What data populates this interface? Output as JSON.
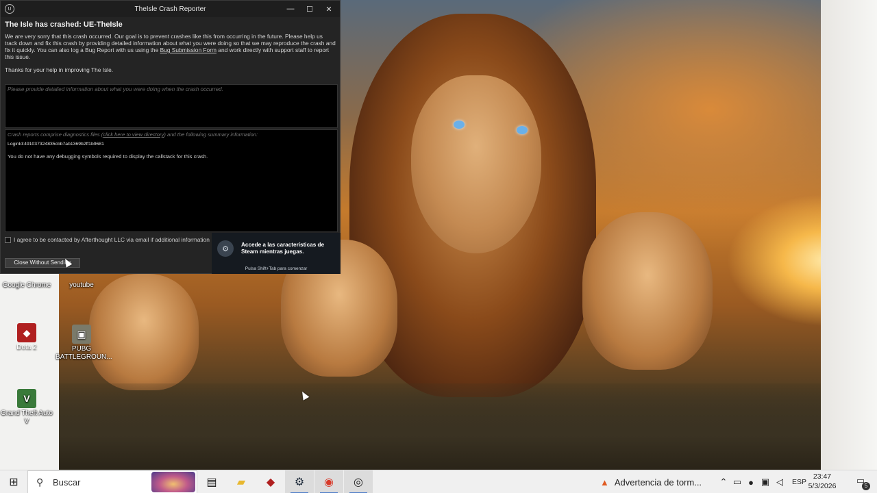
{
  "crash_reporter": {
    "window_title": "TheIsle Crash Reporter",
    "heading": "The Isle has crashed: UE-TheIsle",
    "intro_before_link": "We are very sorry that this crash occurred. Our goal is to prevent crashes like this from occurring in the future. Please help us track down and fix this crash by providing detailed information about what you were doing so that we may reproduce the crash and fix it quickly. You can also log a Bug Report with us using the ",
    "intro_link": "Bug Submission Form",
    "intro_after_link": " and work directly with support staff to report this issue.",
    "thanks": "Thanks for your help in improving The Isle.",
    "description_placeholder": "Please provide detailed information about what you were doing when the crash occurred.",
    "summary_before_link": "Crash reports comprise diagnostics files (",
    "summary_link": "click here to view directory",
    "summary_after_link": ") and the following summary information:",
    "login_id": "LoginId:491037324835cbb7ab1369b2ff1b9681",
    "callstack_msg": "You do not have any debugging symbols required to display the callstack for this crash.",
    "consent_label": "I agree to be contacted by Afterthought LLC via email if additional information",
    "close_button": "Close Without Sending",
    "controls": {
      "minimize": "—",
      "maximize": "☐",
      "close": "✕"
    }
  },
  "steam_overlay": {
    "message": "Accede a las características de Steam mientras juegas.",
    "hint": "Pulsa Shift+Tab para comenzar"
  },
  "desktop_icons": [
    {
      "label": "Google Chrome",
      "icon": "chrome-icon"
    },
    {
      "label": "youtube",
      "icon": "youtube-icon"
    },
    {
      "label": "Dota 2",
      "icon": "dota2-icon"
    },
    {
      "label": "PUBG BATTLEGROUN...",
      "icon": "pubg-icon"
    },
    {
      "label": "Grand Theft Auto V",
      "icon": "gta-icon"
    }
  ],
  "taskbar": {
    "search_placeholder": "Buscar",
    "weather": "Advertencia de torm...",
    "language": "ESP",
    "time": "23:47",
    "date": "5/3/2026",
    "notification_count": "5"
  },
  "colors": {
    "window_bg": "#242424",
    "steam_bg": "#151a20",
    "taskbar_bg": "#f0f0f0",
    "accent": "#4a7ac8"
  }
}
